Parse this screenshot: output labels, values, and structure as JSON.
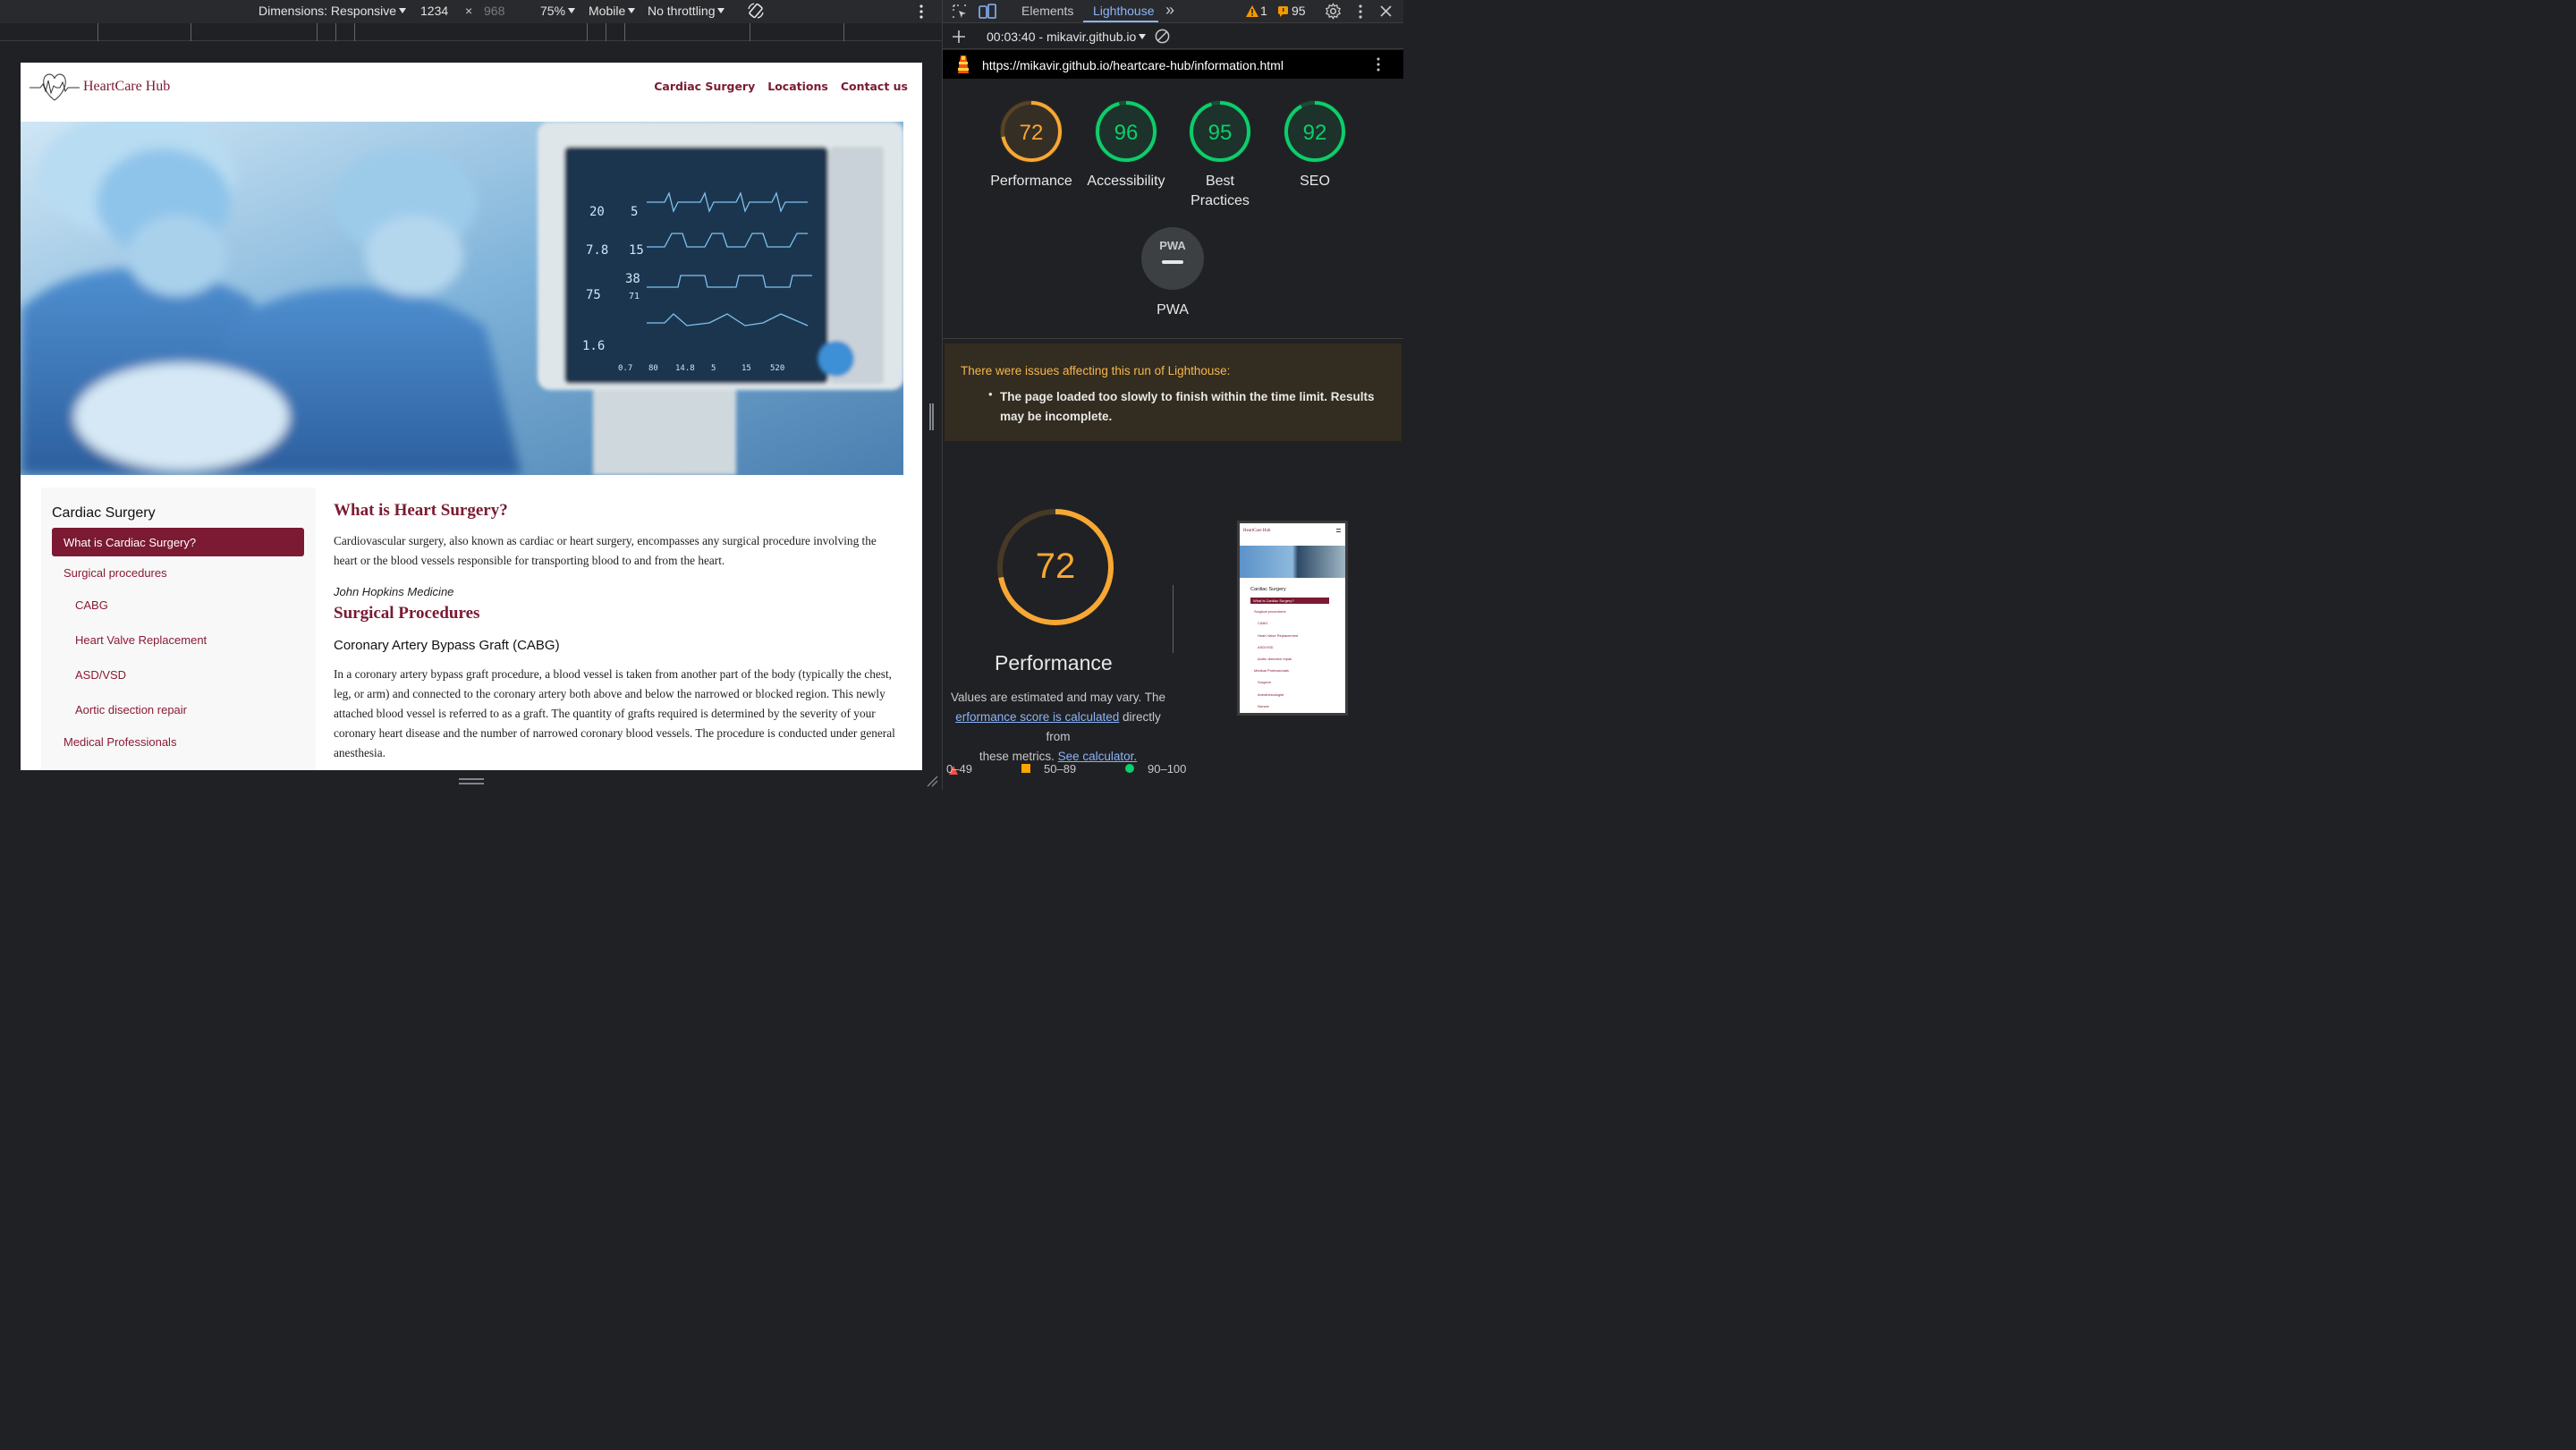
{
  "device_toolbar": {
    "dimensions_label": "Dimensions: Responsive",
    "width": "1234",
    "times": "×",
    "height_placeholder": "968",
    "zoom": "75%",
    "device": "Mobile",
    "throttling": "No throttling"
  },
  "site": {
    "logo_text": "HeartCare Hub",
    "nav": [
      "Cardiac Surgery",
      "Locations",
      "Contact us"
    ],
    "sidebar": {
      "title": "Cardiac Surgery",
      "active_item": "What is Cardiac Surgery?",
      "items": [
        "Surgical procedures",
        "CABG",
        "Heart Valve Replacement",
        "ASD/VSD",
        "Aortic disection repair",
        "Medical Professionals"
      ]
    },
    "article": {
      "h1": "What is Heart Surgery?",
      "p1": "Cardiovascular surgery, also known as cardiac or heart surgery, encompasses any surgical procedure involving the heart or the blood vessels responsible for transporting blood to and from the heart.",
      "source": "John Hopkins Medicine",
      "h2": "Surgical Procedures",
      "h3": "Coronary Artery Bypass Graft (CABG)",
      "p2": "In a coronary artery bypass graft procedure, a blood vessel is taken from another part of the body (typically the chest, leg, or arm) and connected to the coronary artery both above and below the narrowed or blocked region. This newly attached blood vessel is referred to as a graft. The quantity of grafts required is determined by the severity of your coronary heart disease and the number of narrowed coronary blood vessels. The procedure is conducted under general anesthesia."
    },
    "monitor_readings": [
      "20",
      "5",
      "7.8",
      "15",
      "38",
      "75",
      "71",
      "1.6",
      "0.7",
      "80",
      "14.8",
      "5",
      "15",
      "520"
    ]
  },
  "devtools": {
    "tabs": [
      "Elements",
      "Lighthouse"
    ],
    "active_tab": "Lighthouse",
    "more_tabs": "»",
    "warning_count": "1",
    "issue_count": "95",
    "run_label": "00:03:40 - mikavir.github.io",
    "url": "https://mikavir.github.io/heartcare-hub/information.html",
    "scores": [
      {
        "label": "Performance",
        "value": 72,
        "color": "#f7a733"
      },
      {
        "label": "Accessibility",
        "value": 96,
        "color": "#0cce6b"
      },
      {
        "label": "Best Practices",
        "value": 95,
        "color": "#0cce6b"
      },
      {
        "label": "SEO",
        "value": 92,
        "color": "#0cce6b"
      }
    ],
    "pwa": {
      "badge": "PWA",
      "label": "PWA"
    },
    "warning": {
      "title": "There were issues affecting this run of Lighthouse:",
      "item": "The page loaded too slowly to finish within the time limit. Results may be incomplete."
    },
    "performance": {
      "score": 72,
      "label": "Performance",
      "note_line1": "Values are estimated and may vary. The",
      "note_link": "erformance score is calculated",
      "note_mid": " directly from",
      "note_line3": "these metrics. ",
      "note_link2": "See calculator."
    },
    "legend": [
      "0–49",
      "50–89",
      "90–100"
    ],
    "thumbnail": {
      "logo": "HeartCare Hub",
      "title": "Cardiac Surgery",
      "items": [
        "What is Cardiac Surgery?",
        "Surgical procedures",
        "CABG",
        "Heart Valve Replacement",
        "ASD/VSD",
        "Aortic disection repair",
        "Medical Professionals",
        "Surgeon",
        "Anesthesiologist",
        "Nurses"
      ]
    }
  }
}
